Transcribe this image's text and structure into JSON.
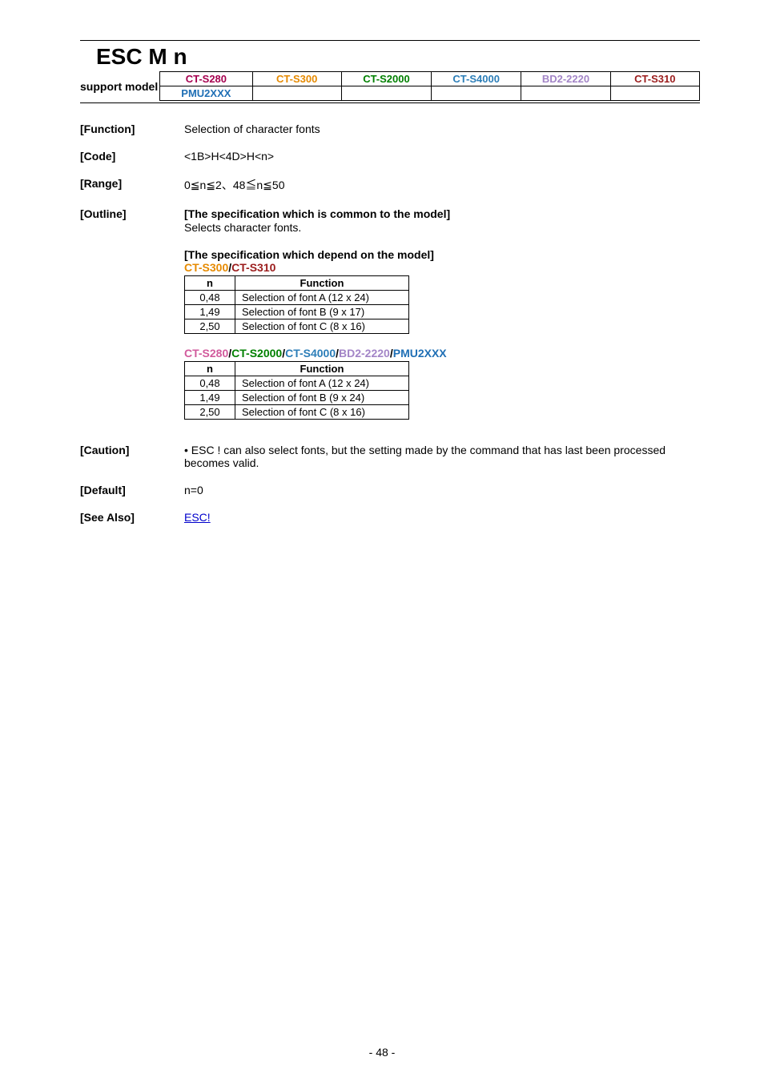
{
  "title": "ESC M n",
  "supportLabel": "support model",
  "support": {
    "r1": [
      {
        "t": "CT-S280",
        "c": "#a6004f"
      },
      {
        "t": "CT-S300",
        "c": "#e68a00"
      },
      {
        "t": "CT-S2000",
        "c": "#008000"
      },
      {
        "t": "CT-S4000",
        "c": "#2c7eb8"
      },
      {
        "t": "BD2-2220",
        "c": "#a385c7"
      },
      {
        "t": "CT-S310",
        "c": "#9b1c1c"
      }
    ],
    "r2c1": {
      "t": "PMU2XXX",
      "c": "#1f6fb5"
    }
  },
  "fields": {
    "function": {
      "label": "[Function]",
      "value": "Selection of character fonts"
    },
    "code": {
      "label": "[Code]",
      "value": "<1B>H<4D>H<n>"
    },
    "range": {
      "label": "[Range]",
      "value": "0≦n≦2、48≦n≦50"
    },
    "outline": {
      "label": "[Outline]",
      "commonTitle": "[The specification which is common to the model]",
      "commonBody": "Selects character fonts.",
      "dependTitle": "[The specification which depend on the model]",
      "line1": [
        {
          "t": "CT-S300",
          "c": "#e68a00"
        },
        {
          "t": "/",
          "c": "#000"
        },
        {
          "t": "CT-S310",
          "c": "#9b1c1c"
        }
      ],
      "table1": {
        "hN": "n",
        "hF": "Function",
        "rows": [
          {
            "n": "0,48",
            "f": "Selection of font A (12 x 24)"
          },
          {
            "n": "1,49",
            "f": "Selection of font B (9 x 17)"
          },
          {
            "n": "2,50",
            "f": "Selection of font C (8 x 16)"
          }
        ]
      },
      "line2": [
        {
          "t": "CT-S280",
          "c": "#d15a9c"
        },
        {
          "t": "/",
          "c": "#000"
        },
        {
          "t": "CT-S2000",
          "c": "#008000"
        },
        {
          "t": "/",
          "c": "#000"
        },
        {
          "t": "CT-S4000",
          "c": "#2c7eb8"
        },
        {
          "t": "/",
          "c": "#000"
        },
        {
          "t": "BD2-2220",
          "c": "#a385c7"
        },
        {
          "t": "/",
          "c": "#000"
        },
        {
          "t": "PMU2XXX",
          "c": "#1f6fb5"
        }
      ],
      "table2": {
        "hN": "n",
        "hF": "Function",
        "rows": [
          {
            "n": "0,48",
            "f": "Selection of font A (12 x 24)"
          },
          {
            "n": "1,49",
            "f": "Selection of font B (9 x 24)"
          },
          {
            "n": "2,50",
            "f": "Selection of font C (8 x 16)"
          }
        ]
      }
    },
    "caution": {
      "label": "[Caution]",
      "value": "• ESC ! can also select fonts, but the setting made by the command that has last been processed becomes valid."
    },
    "default": {
      "label": "[Default]",
      "value": "n=0"
    },
    "seealso": {
      "label": "[See Also]",
      "value": "ESC!"
    }
  },
  "pagenum": "- 48 -"
}
